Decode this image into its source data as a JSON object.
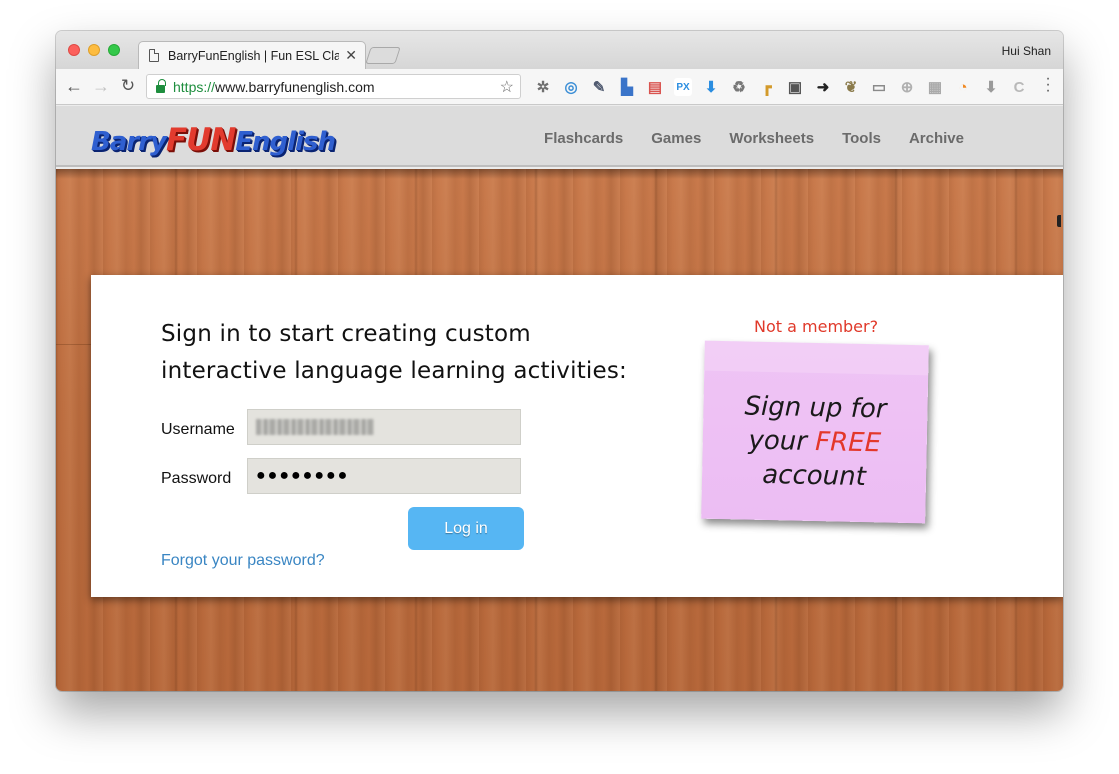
{
  "browser": {
    "tab_title": "BarryFunEnglish | Fun ESL Cla",
    "tab_close": "✕",
    "profile_name": "Hui Shan",
    "url_scheme": "https://",
    "url_host": "www.barryfunenglish.com",
    "extensions": [
      {
        "icon": "bug-icon",
        "color": "#6f6f6f",
        "label": "✲"
      },
      {
        "icon": "compass-icon",
        "color": "#3d8fd6",
        "label": "◎"
      },
      {
        "icon": "eyedropper-icon",
        "color": "#505a70",
        "label": "✎"
      },
      {
        "icon": "stamp-icon",
        "color": "#3a74c9",
        "label": "▙"
      },
      {
        "icon": "calendar-icon",
        "color": "#d9534f",
        "label": "▤"
      },
      {
        "icon": "px-icon",
        "color": "#ffffff",
        "label": "PX"
      },
      {
        "icon": "download-icon",
        "color": "#2a8de0",
        "label": "⬇"
      },
      {
        "icon": "recycle-icon",
        "color": "#777777",
        "label": "♻"
      },
      {
        "icon": "ruler-icon",
        "color": "#d39a2b",
        "label": "┏"
      },
      {
        "icon": "bus-icon",
        "color": "#555555",
        "label": "▣"
      },
      {
        "icon": "arrow-circle-icon",
        "color": "#222222",
        "label": "➜"
      },
      {
        "icon": "leaf-icon",
        "color": "#8a7a4a",
        "label": "❦"
      },
      {
        "icon": "window-icon",
        "color": "#8a8a8a",
        "label": "▭"
      },
      {
        "icon": "save-circle-icon",
        "color": "#b0b0b0",
        "label": "⊕"
      },
      {
        "icon": "tiles-icon",
        "color": "#a9a9a9",
        "label": "▦"
      },
      {
        "icon": "rss-icon",
        "color": "#f08a24",
        "label": "◔"
      },
      {
        "icon": "down-arrow-icon",
        "color": "#9a9a9a",
        "label": "⬇"
      },
      {
        "icon": "c-icon",
        "color": "#b9b9b9",
        "label": "C"
      }
    ]
  },
  "site": {
    "logo": {
      "part1": "Barry",
      "part2": "FUN",
      "part3": "English"
    },
    "nav": [
      "Flashcards",
      "Games",
      "Worksheets",
      "Tools",
      "Archive"
    ]
  },
  "login": {
    "heading": "Sign in to start creating custom interactive language learning activities:",
    "username_label": "Username",
    "password_label": "Password",
    "password_value": "●●●●●●●●",
    "login_button": "Log in",
    "forgot_link": "Forgot your password?"
  },
  "signup": {
    "prompt": "Not a member?",
    "line1": "Sign up for",
    "line2_prefix": "your ",
    "line2_free": "FREE",
    "line3": "account"
  }
}
